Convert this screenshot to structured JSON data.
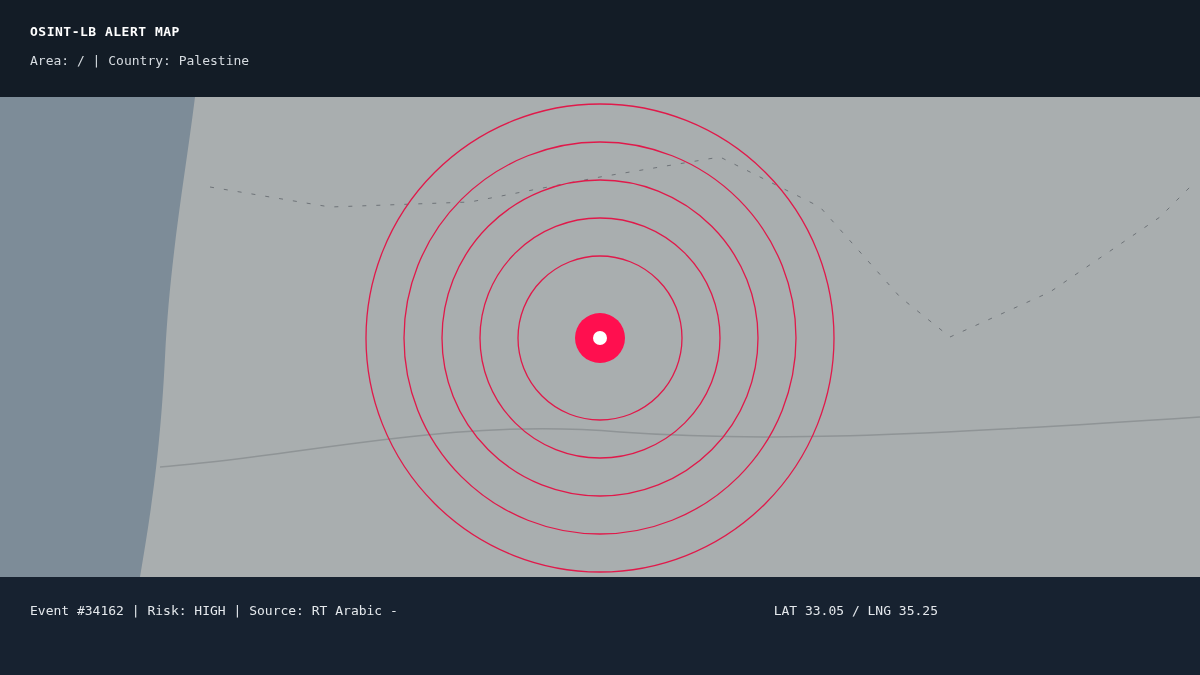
{
  "header": {
    "title": "OSINT-LB ALERT MAP",
    "subtitle": "Area: / | Country: Palestine"
  },
  "footer": {
    "event": "Event #34162 | Risk: HIGH | Source: RT Arabic -",
    "coordinates": "LAT 33.05 / LNG 35.25"
  }
}
